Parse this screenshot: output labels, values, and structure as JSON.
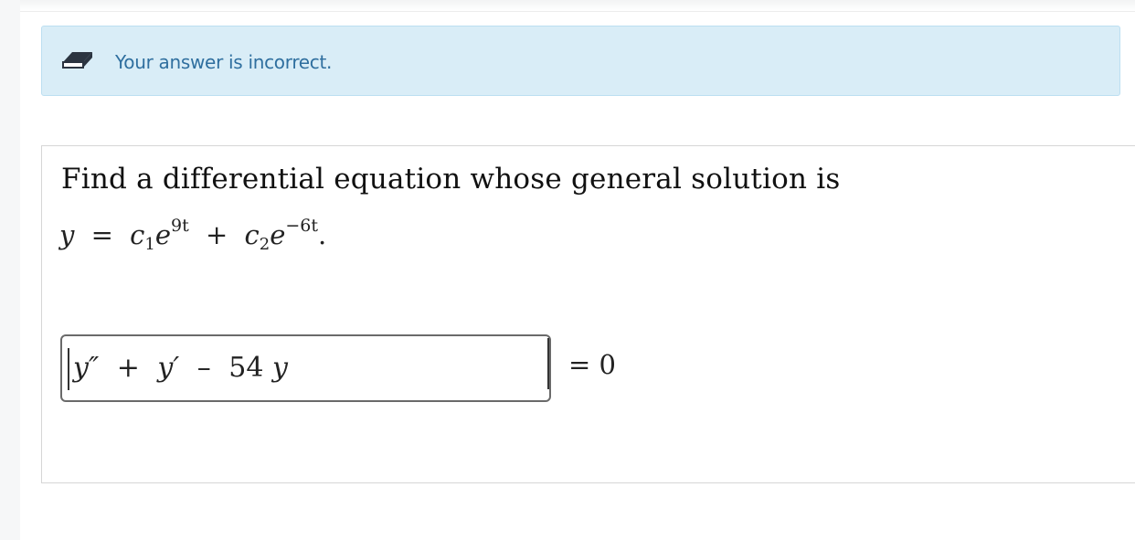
{
  "alert": {
    "icon": "eraser-icon",
    "message": "Your answer is incorrect."
  },
  "question": {
    "prompt": "Find a differential equation whose general solution is",
    "solution": {
      "y": "y",
      "eq": "=",
      "c1": "c",
      "c1_sub": "1",
      "e1": "e",
      "exp1": "9t",
      "plus": "+",
      "c2": "c",
      "c2_sub": "2",
      "e2": "e",
      "exp2": "−6t",
      "period": "."
    },
    "answer": {
      "ypp": "y″",
      "plus": "+",
      "yp": "y′",
      "minus": "–",
      "coef": "54",
      "y": "y"
    },
    "rhs": "= 0"
  }
}
